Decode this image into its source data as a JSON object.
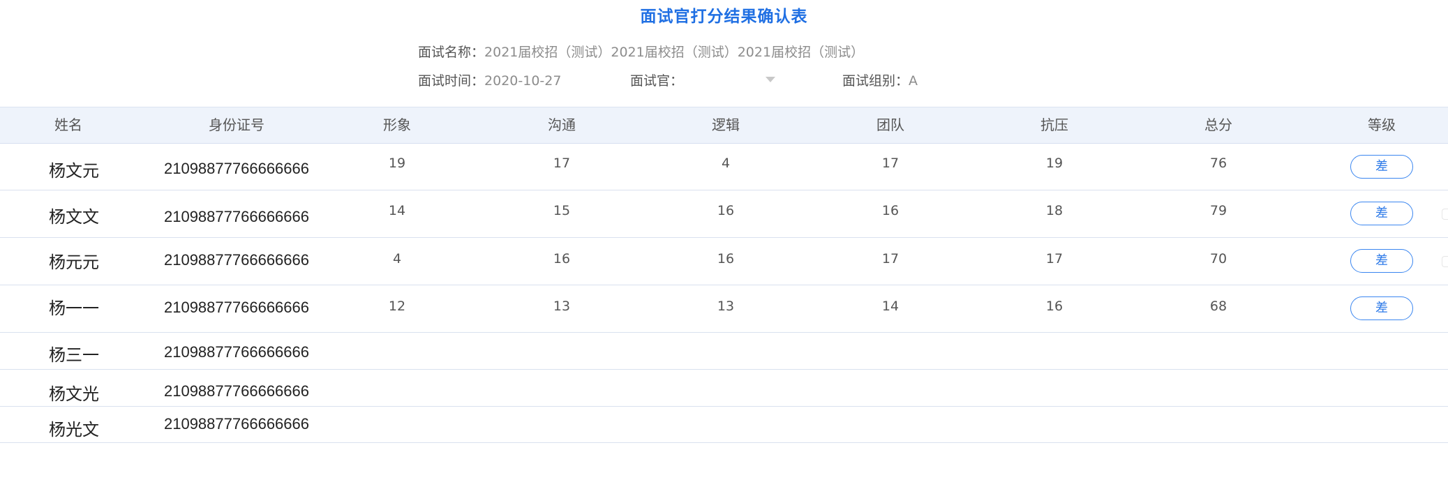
{
  "title": "面试官打分结果确认表",
  "meta": {
    "name_label": "面试名称：",
    "name_value": "2021届校招（测试）2021届校招（测试）2021届校招（测试）",
    "time_label": "面试时间：",
    "time_value": "2020-10-27",
    "interviewer_label": "面试官：",
    "interviewer_value": "",
    "group_label": "面试组别：",
    "group_value": "A"
  },
  "table": {
    "headers": [
      "姓名",
      "身份证号",
      "形象",
      "沟通",
      "逻辑",
      "团队",
      "抗压",
      "总分",
      "等级"
    ],
    "rows": [
      {
        "name": "杨文元",
        "id": "21098877766666666",
        "scores": [
          "19",
          "17",
          "4",
          "17",
          "19",
          "76"
        ],
        "grade": "差"
      },
      {
        "name": "杨文文",
        "id": "21098877766666666",
        "scores": [
          "14",
          "15",
          "16",
          "16",
          "18",
          "79"
        ],
        "grade": "差"
      },
      {
        "name": "杨元元",
        "id": "21098877766666666",
        "scores": [
          "4",
          "16",
          "16",
          "17",
          "17",
          "70"
        ],
        "grade": "差"
      },
      {
        "name": "杨一一",
        "id": "21098877766666666",
        "scores": [
          "12",
          "13",
          "13",
          "14",
          "16",
          "68"
        ],
        "grade": "差"
      },
      {
        "name": "杨三一",
        "id": "21098877766666666"
      },
      {
        "name": "杨文光",
        "id": "21098877766666666"
      },
      {
        "name": "杨光文",
        "id": "21098877766666666"
      }
    ]
  },
  "colors": {
    "accent": "#1f6fe3",
    "header_bg": "#eef3fb",
    "row_border": "#d9e1ef"
  },
  "icons": {
    "interviewer_dropdown": "caret-down-icon"
  }
}
